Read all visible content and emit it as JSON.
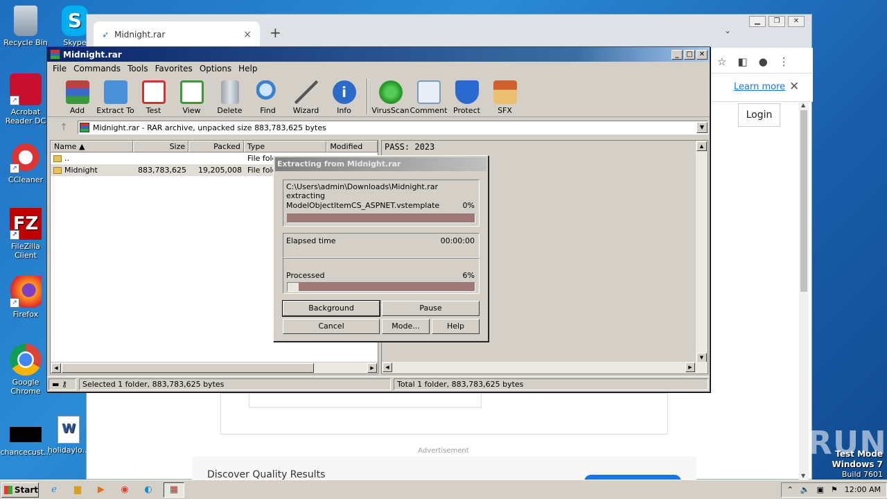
{
  "desktop": {
    "icons": [
      {
        "label": "Recycle Bin",
        "icon": "recycle-bin-icon"
      },
      {
        "label": "Acrobat Reader DC",
        "icon": "acrobat-icon"
      },
      {
        "label": "CCleaner",
        "icon": "ccleaner-icon"
      },
      {
        "label": "FileZilla Client",
        "icon": "filezilla-icon"
      },
      {
        "label": "Firefox",
        "icon": "firefox-icon"
      },
      {
        "label": "Google Chrome",
        "icon": "chrome-icon"
      },
      {
        "label": "chancecust...",
        "icon": "file-icon"
      },
      {
        "label": "Skype",
        "icon": "skype-icon"
      },
      {
        "label": "holidaylo...",
        "icon": "word-doc-icon"
      }
    ],
    "watermark": "ANY RUN",
    "test_mode": {
      "line1": "Test Mode",
      "line2": "Windows 7",
      "line3": "Build 7601"
    }
  },
  "chrome": {
    "tab_title": "Midnight.rar",
    "tab_close": "×",
    "new_tab": "+",
    "learn_more": "Learn more",
    "info_close": "✕",
    "login": "Login",
    "advertisement": "Advertisement",
    "discover": "Discover Quality Results"
  },
  "winrar": {
    "title": "Midnight.rar",
    "menu": [
      "File",
      "Commands",
      "Tools",
      "Favorites",
      "Options",
      "Help"
    ],
    "toolbar": [
      {
        "label": "Add",
        "icon": "add-archive-icon",
        "color": "#c04040"
      },
      {
        "label": "Extract To",
        "icon": "extract-folder-icon",
        "color": "#4a90d9"
      },
      {
        "label": "Test",
        "icon": "test-clipboard-icon",
        "color": "#cc3333"
      },
      {
        "label": "View",
        "icon": "view-book-icon",
        "color": "#3a9a3a"
      },
      {
        "label": "Delete",
        "icon": "trash-icon",
        "color": "#9aa4ae"
      },
      {
        "label": "Find",
        "icon": "magnifier-icon",
        "color": "#3a7fd0"
      },
      {
        "label": "Wizard",
        "icon": "wand-icon",
        "color": "#b0c8d8"
      },
      {
        "label": "Info",
        "icon": "info-icon",
        "color": "#2a6ac8"
      },
      {
        "label": "VirusScan",
        "icon": "virus-icon",
        "color": "#2a9a2a"
      },
      {
        "label": "Comment",
        "icon": "comment-icon",
        "color": "#7a9ac0"
      },
      {
        "label": "Protect",
        "icon": "shield-icon",
        "color": "#2a6ad0"
      },
      {
        "label": "SFX",
        "icon": "sfx-box-icon",
        "color": "#d06030"
      }
    ],
    "address": "Midnight.rar - RAR archive, unpacked size 883,783,625 bytes",
    "columns": [
      "Name",
      "Size",
      "Packed",
      "Type",
      "Modified"
    ],
    "rows": [
      {
        "name": "..",
        "size": "",
        "packed": "",
        "type": "File fold"
      },
      {
        "name": "Midnight",
        "size": "883,783,625",
        "packed": "19,205,008",
        "type": "File fold"
      }
    ],
    "comment": "PASS: 2023",
    "status_left": "Selected 1 folder, 883,783,625 bytes",
    "status_right": "Total 1 folder, 883,783,625 bytes"
  },
  "extract_dialog": {
    "title": "Extracting from Midnight.rar",
    "path": "C:\\Users\\admin\\Downloads\\Midnight.rar",
    "action": "extracting",
    "file": "ModelObjectItemCS_ASPNET.vstemplate",
    "file_percent": "0%",
    "file_progress": 0,
    "elapsed_label": "Elapsed time",
    "elapsed": "00:00:00",
    "processed_label": "Processed",
    "processed_percent": "6%",
    "processed_progress": 0.06,
    "buttons": {
      "background": "Background",
      "pause": "Pause",
      "cancel": "Cancel",
      "mode": "Mode...",
      "help": "Help"
    }
  },
  "taskbar": {
    "start": "Start",
    "clock": "12:00 AM"
  }
}
